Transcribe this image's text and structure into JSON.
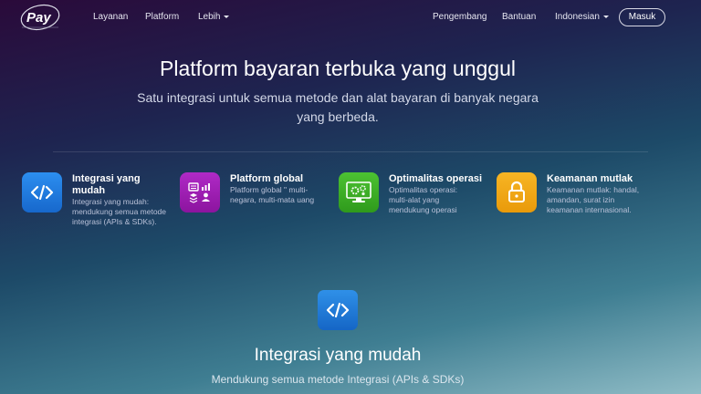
{
  "nav": {
    "logo_text": "Pay",
    "items": [
      {
        "label": "Layanan"
      },
      {
        "label": "Platform"
      },
      {
        "label": "Lebih"
      }
    ],
    "right_items": [
      {
        "label": "Pengembang"
      },
      {
        "label": "Bantuan"
      },
      {
        "label": "Indonesian"
      }
    ],
    "login_label": "Masuk"
  },
  "hero": {
    "title": "Platform bayaran terbuka yang unggul",
    "subtitle": "Satu integrasi untuk semua metode dan alat bayaran di banyak negara yang berbeda."
  },
  "features": [
    {
      "icon": "code-icon",
      "color": "#1f7fdc",
      "title": "Integrasi yang mudah",
      "desc": "Integrasi yang mudah: mendukung semua metode integrasi (APIs & SDKs)."
    },
    {
      "icon": "global-stats-icon",
      "color": "#9c1fb0",
      "title": "Platform global",
      "desc": "Platform global \" multi-negara, multi-mata uang"
    },
    {
      "icon": "monitor-gear-icon",
      "color": "#3fae2a",
      "title": "Optimalitas operasi",
      "desc": "Optimalitas operasi: multi-alat yang mendukung operasi"
    },
    {
      "icon": "lock-icon",
      "color": "#f2a516",
      "title": "Keamanan mutlak",
      "desc": "Keamanan mutlak: handal, amandan, surat izin keamanan internasional."
    }
  ],
  "section": {
    "icon": "code-icon",
    "title": "Integrasi yang mudah",
    "subtitle": "Mendukung semua metode Integrasi (APIs & SDKs)"
  }
}
